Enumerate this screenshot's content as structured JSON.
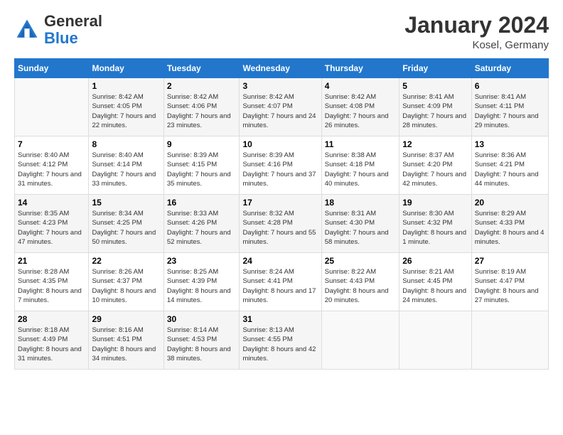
{
  "header": {
    "logo_general": "General",
    "logo_blue": "Blue",
    "month_title": "January 2024",
    "location": "Kosel, Germany"
  },
  "days_of_week": [
    "Sunday",
    "Monday",
    "Tuesday",
    "Wednesday",
    "Thursday",
    "Friday",
    "Saturday"
  ],
  "weeks": [
    [
      {
        "day": "",
        "sunrise": "",
        "sunset": "",
        "daylight": ""
      },
      {
        "day": "1",
        "sunrise": "Sunrise: 8:42 AM",
        "sunset": "Sunset: 4:05 PM",
        "daylight": "Daylight: 7 hours and 22 minutes."
      },
      {
        "day": "2",
        "sunrise": "Sunrise: 8:42 AM",
        "sunset": "Sunset: 4:06 PM",
        "daylight": "Daylight: 7 hours and 23 minutes."
      },
      {
        "day": "3",
        "sunrise": "Sunrise: 8:42 AM",
        "sunset": "Sunset: 4:07 PM",
        "daylight": "Daylight: 7 hours and 24 minutes."
      },
      {
        "day": "4",
        "sunrise": "Sunrise: 8:42 AM",
        "sunset": "Sunset: 4:08 PM",
        "daylight": "Daylight: 7 hours and 26 minutes."
      },
      {
        "day": "5",
        "sunrise": "Sunrise: 8:41 AM",
        "sunset": "Sunset: 4:09 PM",
        "daylight": "Daylight: 7 hours and 28 minutes."
      },
      {
        "day": "6",
        "sunrise": "Sunrise: 8:41 AM",
        "sunset": "Sunset: 4:11 PM",
        "daylight": "Daylight: 7 hours and 29 minutes."
      }
    ],
    [
      {
        "day": "7",
        "sunrise": "Sunrise: 8:40 AM",
        "sunset": "Sunset: 4:12 PM",
        "daylight": "Daylight: 7 hours and 31 minutes."
      },
      {
        "day": "8",
        "sunrise": "Sunrise: 8:40 AM",
        "sunset": "Sunset: 4:14 PM",
        "daylight": "Daylight: 7 hours and 33 minutes."
      },
      {
        "day": "9",
        "sunrise": "Sunrise: 8:39 AM",
        "sunset": "Sunset: 4:15 PM",
        "daylight": "Daylight: 7 hours and 35 minutes."
      },
      {
        "day": "10",
        "sunrise": "Sunrise: 8:39 AM",
        "sunset": "Sunset: 4:16 PM",
        "daylight": "Daylight: 7 hours and 37 minutes."
      },
      {
        "day": "11",
        "sunrise": "Sunrise: 8:38 AM",
        "sunset": "Sunset: 4:18 PM",
        "daylight": "Daylight: 7 hours and 40 minutes."
      },
      {
        "day": "12",
        "sunrise": "Sunrise: 8:37 AM",
        "sunset": "Sunset: 4:20 PM",
        "daylight": "Daylight: 7 hours and 42 minutes."
      },
      {
        "day": "13",
        "sunrise": "Sunrise: 8:36 AM",
        "sunset": "Sunset: 4:21 PM",
        "daylight": "Daylight: 7 hours and 44 minutes."
      }
    ],
    [
      {
        "day": "14",
        "sunrise": "Sunrise: 8:35 AM",
        "sunset": "Sunset: 4:23 PM",
        "daylight": "Daylight: 7 hours and 47 minutes."
      },
      {
        "day": "15",
        "sunrise": "Sunrise: 8:34 AM",
        "sunset": "Sunset: 4:25 PM",
        "daylight": "Daylight: 7 hours and 50 minutes."
      },
      {
        "day": "16",
        "sunrise": "Sunrise: 8:33 AM",
        "sunset": "Sunset: 4:26 PM",
        "daylight": "Daylight: 7 hours and 52 minutes."
      },
      {
        "day": "17",
        "sunrise": "Sunrise: 8:32 AM",
        "sunset": "Sunset: 4:28 PM",
        "daylight": "Daylight: 7 hours and 55 minutes."
      },
      {
        "day": "18",
        "sunrise": "Sunrise: 8:31 AM",
        "sunset": "Sunset: 4:30 PM",
        "daylight": "Daylight: 7 hours and 58 minutes."
      },
      {
        "day": "19",
        "sunrise": "Sunrise: 8:30 AM",
        "sunset": "Sunset: 4:32 PM",
        "daylight": "Daylight: 8 hours and 1 minute."
      },
      {
        "day": "20",
        "sunrise": "Sunrise: 8:29 AM",
        "sunset": "Sunset: 4:33 PM",
        "daylight": "Daylight: 8 hours and 4 minutes."
      }
    ],
    [
      {
        "day": "21",
        "sunrise": "Sunrise: 8:28 AM",
        "sunset": "Sunset: 4:35 PM",
        "daylight": "Daylight: 8 hours and 7 minutes."
      },
      {
        "day": "22",
        "sunrise": "Sunrise: 8:26 AM",
        "sunset": "Sunset: 4:37 PM",
        "daylight": "Daylight: 8 hours and 10 minutes."
      },
      {
        "day": "23",
        "sunrise": "Sunrise: 8:25 AM",
        "sunset": "Sunset: 4:39 PM",
        "daylight": "Daylight: 8 hours and 14 minutes."
      },
      {
        "day": "24",
        "sunrise": "Sunrise: 8:24 AM",
        "sunset": "Sunset: 4:41 PM",
        "daylight": "Daylight: 8 hours and 17 minutes."
      },
      {
        "day": "25",
        "sunrise": "Sunrise: 8:22 AM",
        "sunset": "Sunset: 4:43 PM",
        "daylight": "Daylight: 8 hours and 20 minutes."
      },
      {
        "day": "26",
        "sunrise": "Sunrise: 8:21 AM",
        "sunset": "Sunset: 4:45 PM",
        "daylight": "Daylight: 8 hours and 24 minutes."
      },
      {
        "day": "27",
        "sunrise": "Sunrise: 8:19 AM",
        "sunset": "Sunset: 4:47 PM",
        "daylight": "Daylight: 8 hours and 27 minutes."
      }
    ],
    [
      {
        "day": "28",
        "sunrise": "Sunrise: 8:18 AM",
        "sunset": "Sunset: 4:49 PM",
        "daylight": "Daylight: 8 hours and 31 minutes."
      },
      {
        "day": "29",
        "sunrise": "Sunrise: 8:16 AM",
        "sunset": "Sunset: 4:51 PM",
        "daylight": "Daylight: 8 hours and 34 minutes."
      },
      {
        "day": "30",
        "sunrise": "Sunrise: 8:14 AM",
        "sunset": "Sunset: 4:53 PM",
        "daylight": "Daylight: 8 hours and 38 minutes."
      },
      {
        "day": "31",
        "sunrise": "Sunrise: 8:13 AM",
        "sunset": "Sunset: 4:55 PM",
        "daylight": "Daylight: 8 hours and 42 minutes."
      },
      {
        "day": "",
        "sunrise": "",
        "sunset": "",
        "daylight": ""
      },
      {
        "day": "",
        "sunrise": "",
        "sunset": "",
        "daylight": ""
      },
      {
        "day": "",
        "sunrise": "",
        "sunset": "",
        "daylight": ""
      }
    ]
  ]
}
